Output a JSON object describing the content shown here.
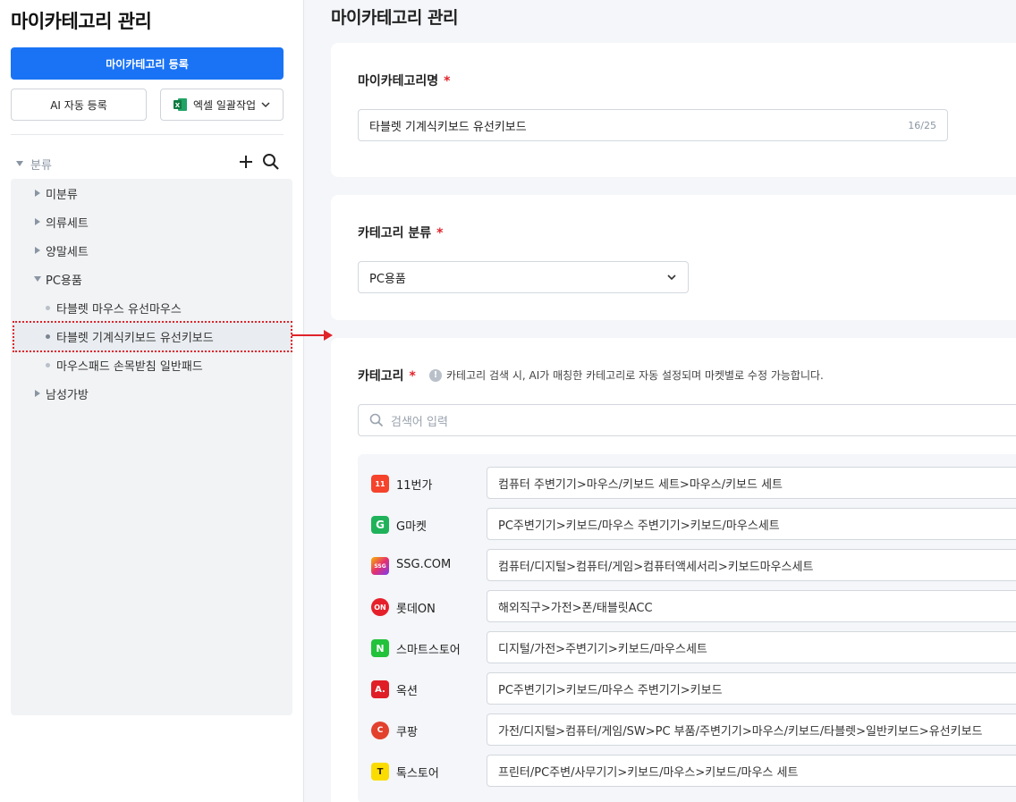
{
  "sidebar": {
    "title": "마이카테고리 관리",
    "register_button": "마이카테고리 등록",
    "ai_button": "AI 자동 등록",
    "excel_button": "엑셀 일괄작업",
    "tree_header": "분류",
    "tree": [
      {
        "label": "미분류",
        "type": "folder",
        "expanded": false
      },
      {
        "label": "의류세트",
        "type": "folder",
        "expanded": false
      },
      {
        "label": "양말세트",
        "type": "folder",
        "expanded": false
      },
      {
        "label": "PC용품",
        "type": "folder",
        "expanded": true
      },
      {
        "label": "타블렛 마우스 유선마우스",
        "type": "leaf"
      },
      {
        "label": "타블렛 기계식키보드 유선키보드",
        "type": "leaf",
        "selected": true
      },
      {
        "label": "마우스패드 손목받침 일반패드",
        "type": "leaf"
      },
      {
        "label": "남성가방",
        "type": "folder",
        "expanded": false
      }
    ]
  },
  "main": {
    "title": "마이카테고리 관리",
    "name_section": {
      "label": "마이카테고리명",
      "required_mark": "*",
      "value": "타블렛 기계식키보드 유선키보드",
      "counter": "16/25"
    },
    "classification_section": {
      "label": "카테고리 분류",
      "required_mark": "*",
      "selected": "PC용품"
    },
    "category_section": {
      "label": "카테고리",
      "required_mark": "*",
      "info_text": "카테고리 검색 시, AI가 매칭한 카테고리로 자동 설정되며 마켓별로 수정 가능합니다.",
      "search_placeholder": "검색어 입력",
      "markets": [
        {
          "name": "11번가",
          "logo_text": "11",
          "color": "#f5432c",
          "path": "컴퓨터 주변기기>마우스/키보드 세트>마우스/키보드 세트"
        },
        {
          "name": "G마켓",
          "logo_text": "G",
          "color": "#1fb25a",
          "path": "PC주변기기>키보드/마우스 주변기기>키보드/마우스세트"
        },
        {
          "name": "SSG.COM",
          "logo_text": "SSG",
          "color": "#e5306e",
          "path": "컴퓨터/디지털>컴퓨터/게임>컴퓨터액세서리>키보드마우스세트"
        },
        {
          "name": "롯데ON",
          "logo_text": "ON",
          "color": "#e5202b",
          "path": "해외직구>가전>폰/태블릿ACC"
        },
        {
          "name": "스마트스토어",
          "logo_text": "N",
          "color": "#22c23b",
          "path": "디지털/가전>주변기기>키보드/마우스세트"
        },
        {
          "name": "옥션",
          "logo_text": "A.",
          "color": "#e01e26",
          "path": "PC주변기기>키보드/마우스 주변기기>키보드"
        },
        {
          "name": "쿠팡",
          "logo_text": "C",
          "color": "#e2412e",
          "path": "가전/디지털>컴퓨터/게임/SW>PC 부품/주변기기>마우스/키보드/타블렛>일반키보드>유선키보드"
        },
        {
          "name": "톡스토어",
          "logo_text": "T",
          "color": "#fadc00",
          "path": "프린터/PC주변/사무기기>키보드/마우스>키보드/마우스 세트"
        }
      ]
    }
  }
}
